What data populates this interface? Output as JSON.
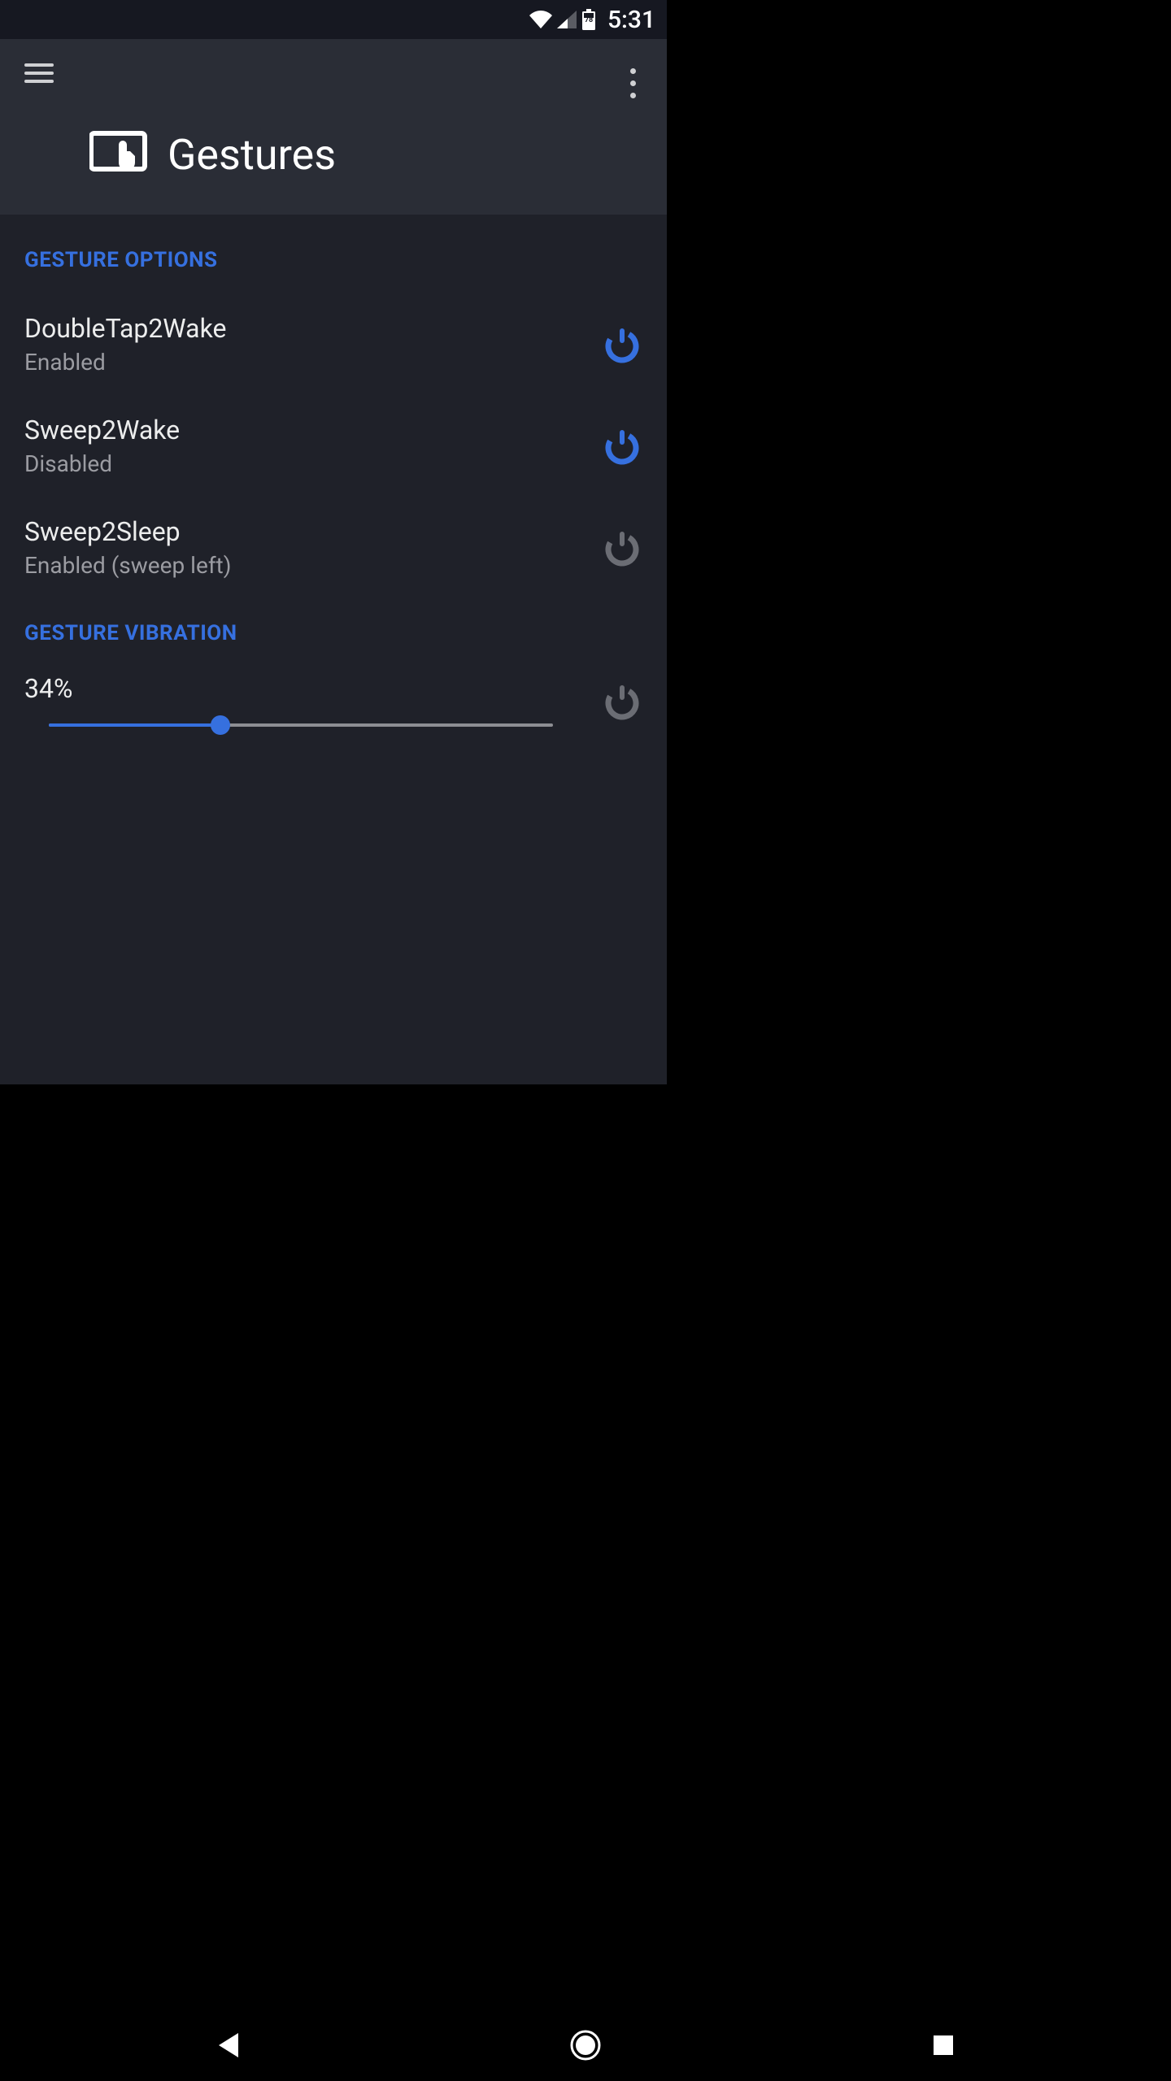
{
  "status": {
    "time": "5:31",
    "battery_pct": "78"
  },
  "header": {
    "title": "Gestures"
  },
  "sections": {
    "options_header": "GESTURE OPTIONS",
    "vibration_header": "GESTURE VIBRATION"
  },
  "prefs": {
    "dt2w": {
      "title": "DoubleTap2Wake",
      "sub": "Enabled",
      "active": true
    },
    "s2w": {
      "title": "Sweep2Wake",
      "sub": "Disabled",
      "active": true
    },
    "s2s": {
      "title": "Sweep2Sleep",
      "sub": "Enabled (sweep left)",
      "active": false
    }
  },
  "vibration": {
    "label": "34%",
    "percent": 34,
    "active": false
  },
  "colors": {
    "accent": "#3670df",
    "icon_inactive": "#6b6d74"
  }
}
